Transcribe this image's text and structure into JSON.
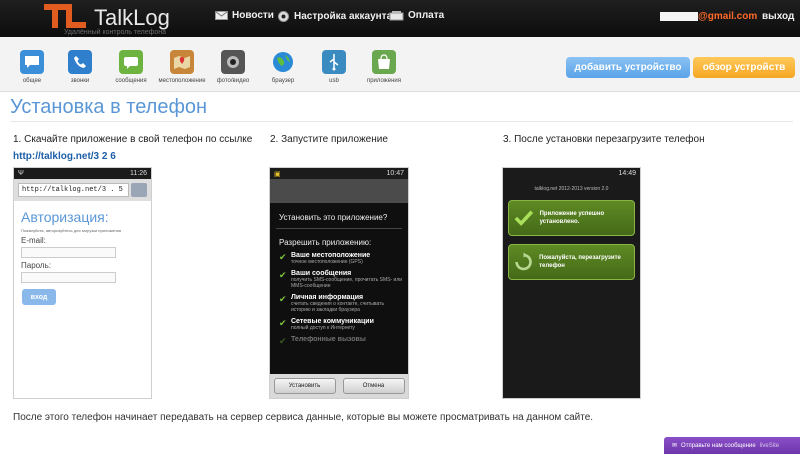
{
  "header": {
    "logo_text": "TalkLog",
    "logo_sub": "Удалённый контроль телефона",
    "nav": [
      {
        "label": "Новости",
        "icon": "mail-icon"
      },
      {
        "label": "Настройка аккаунта",
        "icon": "gear-icon"
      },
      {
        "label": "Оплата",
        "icon": "cash-icon"
      }
    ],
    "email_suffix": "@gmail.com",
    "logout": "выход"
  },
  "toolbar": {
    "tools": [
      {
        "label": "общее",
        "icon": "chat-icon",
        "color": "#3b8fd8"
      },
      {
        "label": "звонки",
        "icon": "phone-icon",
        "color": "#2f7fcc"
      },
      {
        "label": "сообщения",
        "icon": "sms-icon",
        "color": "#6db33f"
      },
      {
        "label": "местоположение",
        "icon": "map-icon",
        "color": "#c8863a"
      },
      {
        "label": "фото/видео",
        "icon": "camera-icon",
        "color": "#555555"
      },
      {
        "label": "браузер",
        "icon": "globe-icon",
        "color": "#2b8ad6"
      },
      {
        "label": "usb",
        "icon": "usb-icon",
        "color": "#3a8cc0"
      },
      {
        "label": "приложения",
        "icon": "app-store-icon",
        "color": "#6aa84f"
      }
    ],
    "add_device": "добавить устройство",
    "review_devices": "обзор устройств"
  },
  "main": {
    "title": "Установка в телефон",
    "step1": "1. Скачайте приложение в свой телефон по ссылке",
    "link": "http://talklog.net/3  2  6",
    "step2": "2. Запустите приложение",
    "step3": "3. После установки перезагрузите телефон",
    "footnote": "После этого телефон начинает передавать на сервер сервиса данные, которые вы можете просматривать на данном сайте."
  },
  "phone1": {
    "time": "11:26",
    "url": "http://talklog.net/3 . 5",
    "auth_title": "Авторизация:",
    "auth_hint": "Пожалуйста, авторизуйтесь для загрузки приложения",
    "email_label": "E-mail:",
    "password_label": "Пароль:",
    "enter": "вход"
  },
  "phone2": {
    "time": "10:47",
    "question": "Установить это приложение?",
    "allow": "Разрешить приложению:",
    "perms": [
      {
        "title": "Ваше местоположение",
        "desc": "точное местоположение (GPS)"
      },
      {
        "title": "Ваши сообщения",
        "desc": "получить SMS-сообщение, прочитать SMS- или MMS-сообщение"
      },
      {
        "title": "Личная информация",
        "desc": "считать сведения о контакте, считывать историю и закладки браузера"
      },
      {
        "title": "Сетевые коммуникации",
        "desc": "полный доступ к Интернету"
      },
      {
        "title": "Телефонные вызовы",
        "desc": ""
      }
    ],
    "install": "Установить",
    "cancel": "Отмена"
  },
  "phone3": {
    "time": "14:49",
    "caption": "talklog.net 2012-2013 version 2.0",
    "ok_card": "Приложение успешно установлено.",
    "reboot_card": "Пожалуйста, перезагрузите телефон"
  },
  "chat": {
    "label": "Отправьте нам сообщение",
    "brand": "liveSite"
  }
}
